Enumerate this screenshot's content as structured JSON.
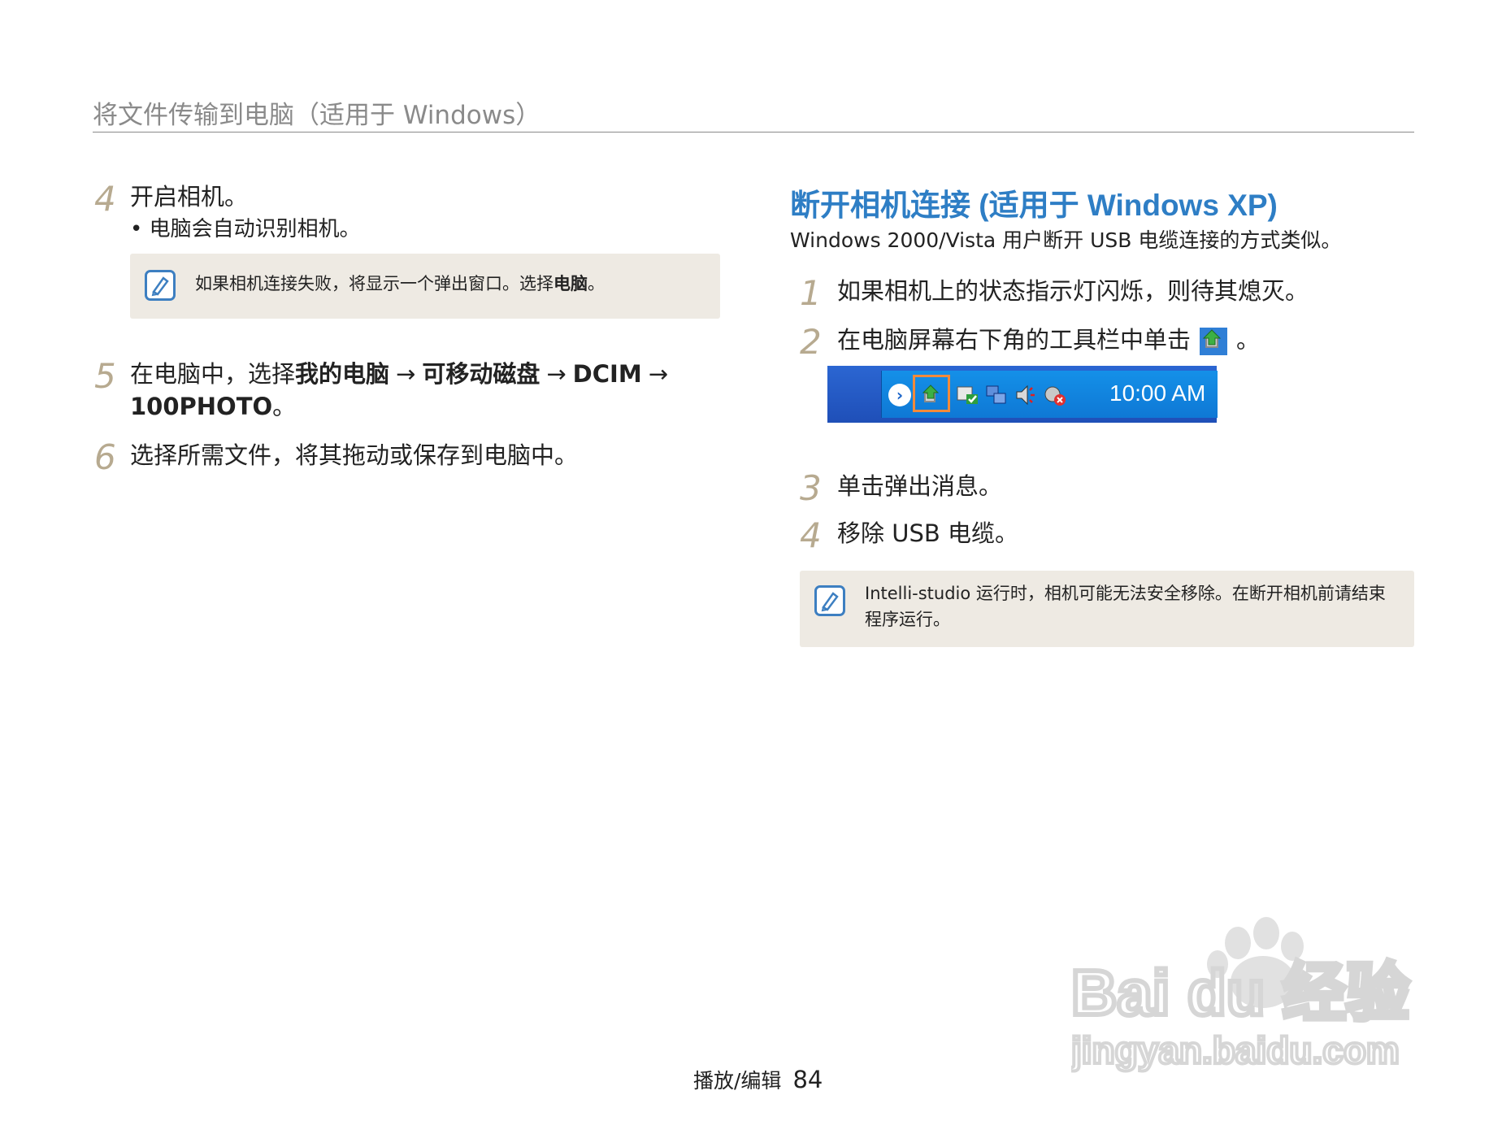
{
  "header": {
    "title": "将文件传输到电脑（适用于 Windows）"
  },
  "left": {
    "step4": {
      "num": "4",
      "text": "开启相机。",
      "bullet": "电脑会自动识别相机。"
    },
    "note1": {
      "text_pre": "如果相机连接失败，将显示一个弹出窗口。选择",
      "text_bold": "电脑",
      "text_post": "。"
    },
    "step5": {
      "num": "5",
      "pre": "在电脑中，选择",
      "b1": "我的电脑",
      "arrow": "→",
      "b2": "可移动磁盘",
      "b3": "DCIM",
      "b4": "100PHOTO",
      "end": "。"
    },
    "step6": {
      "num": "6",
      "text": "选择所需文件，将其拖动或保存到电脑中。"
    }
  },
  "right": {
    "title": "断开相机连接 (适用于 Windows XP)",
    "subtitle": "Windows 2000/Vista 用户断开 USB 电缆连接的方式类似。",
    "step1": {
      "num": "1",
      "text": "如果相机上的状态指示灯闪烁，则待其熄灭。"
    },
    "step2": {
      "num": "2",
      "text": "在电脑屏幕右下角的工具栏中单击",
      "end": "。"
    },
    "taskbar": {
      "clock": "10:00 AM"
    },
    "step3": {
      "num": "3",
      "text": "单击弹出消息。"
    },
    "step4": {
      "num": "4",
      "text": "移除 USB 电缆。"
    },
    "note2": {
      "text": "Intelli-studio 运行时，相机可能无法安全移除。在断开相机前请结束程序运行。"
    }
  },
  "watermark": {
    "brand": "Bai du 经验",
    "url": "jingyan.baidu.com"
  },
  "footer": {
    "section": "播放/编辑",
    "page": "84"
  },
  "colors": {
    "accent": "#2e7ec5",
    "step_number": "#b7aa90",
    "note_bg": "#eeeae3"
  }
}
